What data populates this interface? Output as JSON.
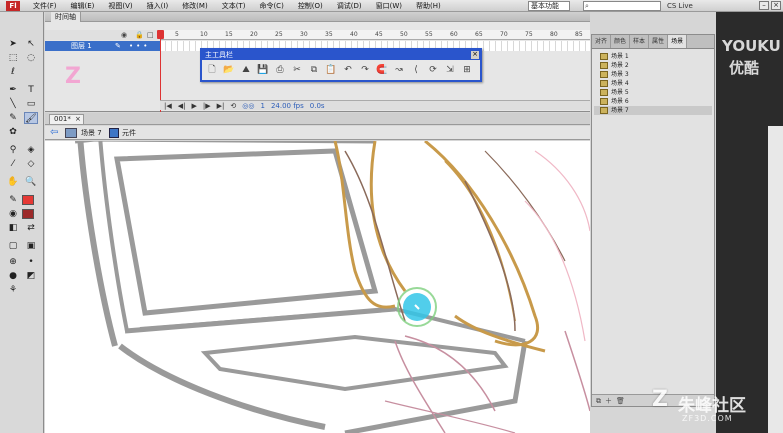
{
  "menu": {
    "items": [
      "文件(F)",
      "编辑(E)",
      "视图(V)",
      "插入(I)",
      "修改(M)",
      "文本(T)",
      "命令(C)",
      "控制(O)",
      "调试(D)",
      "窗口(W)",
      "帮助(H)"
    ],
    "workspace": "基本功能",
    "search_placeholder": "",
    "cs_live": "CS Live",
    "win_min": "–",
    "win_close": "×"
  },
  "timeline": {
    "tab_label": "时间轴",
    "layer_name": "图层 1",
    "ticks": [
      "5",
      "10",
      "15",
      "20",
      "25",
      "30",
      "35",
      "40",
      "45",
      "50",
      "55",
      "60",
      "65",
      "70",
      "75",
      "80",
      "85"
    ],
    "thumb": "Z",
    "fps": "24.00 fps",
    "time": "0.0s",
    "frame": "1"
  },
  "floating_toolbar": {
    "title": "主工具栏",
    "close": "×"
  },
  "document": {
    "tab_label": "001*",
    "tab_close": "×",
    "scene_name": "场景 7",
    "symbol_name": "元件"
  },
  "scene_panel": {
    "tabs": [
      "对齐",
      "颜色",
      "样本",
      "属性",
      "场景"
    ],
    "active_tab": "场景",
    "scenes": [
      "场景 1",
      "场景 2",
      "场景 3",
      "场景 4",
      "场景 5",
      "场景 6",
      "场景 7"
    ],
    "selected_scene": "场景 7"
  },
  "watermarks": {
    "youku_en": "YOUKU",
    "youku_cn": "优酷",
    "zf_cn": "朱峰社区",
    "zf_url": "ZF3D.COM"
  },
  "colors": {
    "accent_blue": "#2a55cc",
    "stroke_color": "#e53935",
    "fill_color": "#9c2a2a",
    "cursor_highlight": "#33c6e8"
  }
}
